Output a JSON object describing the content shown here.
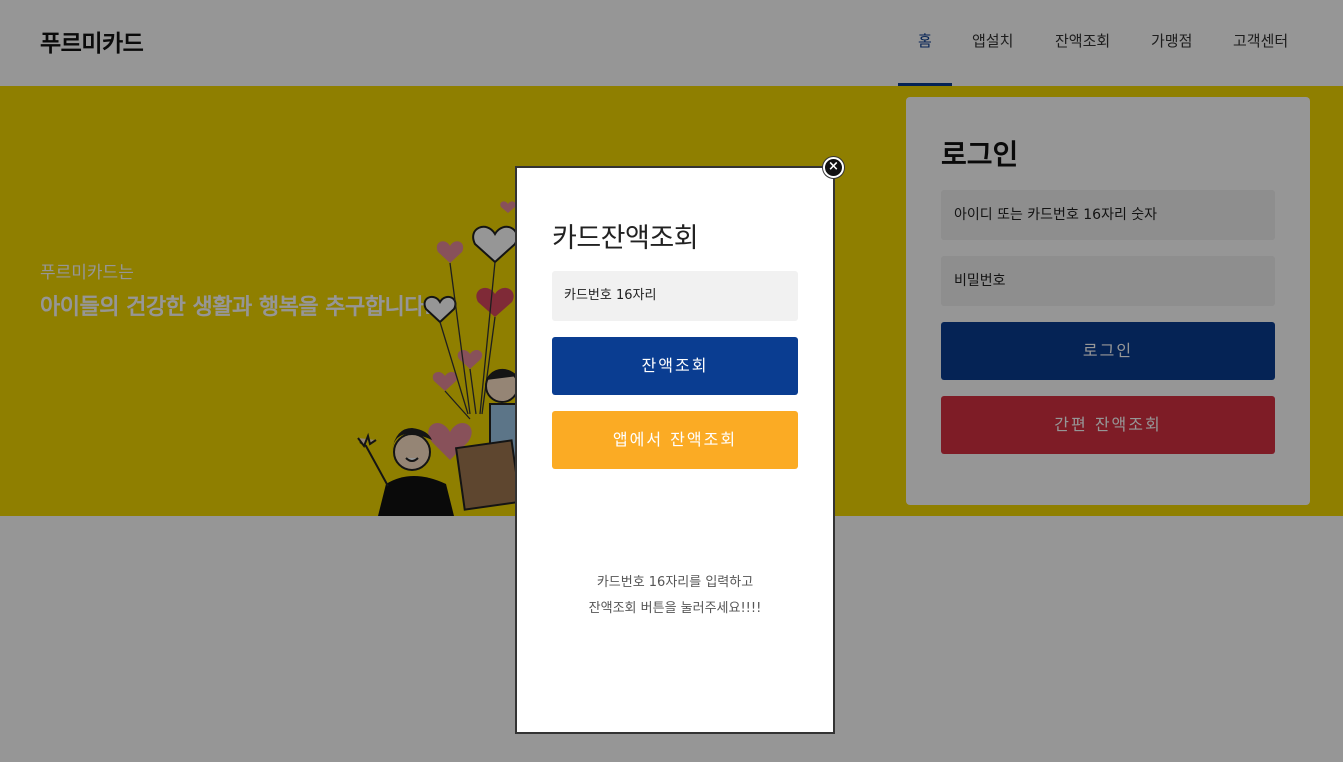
{
  "header": {
    "logo": "푸르미카드",
    "nav": [
      {
        "label": "홈",
        "active": true
      },
      {
        "label": "앱설치",
        "active": false
      },
      {
        "label": "잔액조회",
        "active": false
      },
      {
        "label": "가맹점",
        "active": false
      },
      {
        "label": "고객센터",
        "active": false
      }
    ]
  },
  "hero": {
    "subtitle": "푸르미카드는",
    "title": "아이들의 건강한 생활과 행복을 추구합니다.",
    "background_color": "#f3d800",
    "illustration": "people-with-hearts-illustration"
  },
  "login": {
    "title": "로그인",
    "id_placeholder": "아이디 또는 카드번호 16자리 숫자",
    "password_placeholder": "비밀번호",
    "login_button": "로그인",
    "quick_balance_button": "간편 잔액조회",
    "colors": {
      "primary": "#0a3d91",
      "danger": "#d73042"
    }
  },
  "modal": {
    "title": "카드잔액조회",
    "card_placeholder": "카드번호 16자리",
    "balance_button": "잔액조회",
    "app_balance_button": "앱에서 잔액조회",
    "help_line1": "카드번호 16자리를 입력하고",
    "help_line2": "잔액조회 버튼을 눌러주세요!!!!",
    "close_icon": "×",
    "colors": {
      "primary": "#0a3d91",
      "accent": "#fbab24"
    }
  }
}
